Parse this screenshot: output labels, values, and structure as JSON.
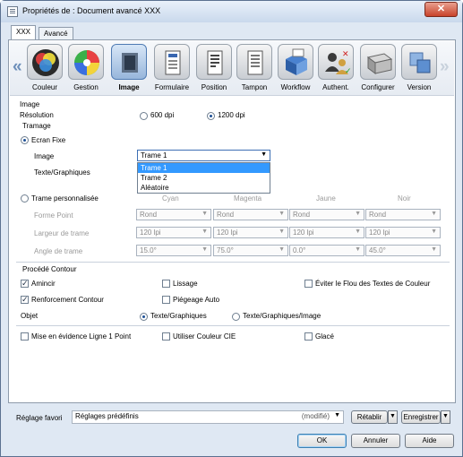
{
  "window": {
    "title": "Propriétés de : Document avancé XXX",
    "close_label": "✕"
  },
  "tabs": [
    {
      "label": "XXX"
    },
    {
      "label": "Avancé"
    }
  ],
  "toolbar": {
    "items": [
      {
        "label": "Couleur",
        "icon": "color-circles-icon"
      },
      {
        "label": "Gestion",
        "icon": "color-wheel-icon"
      },
      {
        "label": "Image",
        "icon": "image-icon"
      },
      {
        "label": "Formulaire",
        "icon": "form-icon"
      },
      {
        "label": "Position",
        "icon": "position-icon"
      },
      {
        "label": "Tampon",
        "icon": "stamp-icon"
      },
      {
        "label": "Workflow",
        "icon": "workflow-icon"
      },
      {
        "label": "Authent.",
        "icon": "authentication-icon"
      },
      {
        "label": "Configurer",
        "icon": "configure-icon"
      },
      {
        "label": "Version",
        "icon": "version-icon"
      }
    ],
    "left_arrow": "«",
    "right_arrow": "»"
  },
  "image_section": {
    "header": "Image",
    "resolution_label": "Résolution",
    "res_600": "600 dpi",
    "res_1200": "1200 dpi",
    "tramage_label": "Tramage",
    "ecran_fixe": "Ecran Fixe",
    "image_label": "Image",
    "texte_graphiques_label": "Texte/Graphiques",
    "image_select_value": "Trame 1",
    "dropdown_options": [
      "Trame 1",
      "Trame 2",
      "Aléatoire"
    ],
    "trame_perso": "Trame personnalisée",
    "col_headers": [
      "Cyan",
      "Magenta",
      "Jaune",
      "Noir"
    ],
    "forme_point_label": "Forme Point",
    "largeur_label": "Largeur de trame",
    "angle_label": "Angle de trame",
    "forme_values": [
      "Rond",
      "Rond",
      "Rond",
      "Rond"
    ],
    "largeur_values": [
      "120 lpi",
      "120 lpi",
      "120 lpi",
      "120 lpi"
    ],
    "angle_values": [
      "15.0°",
      "75.0°",
      "0.0°",
      "45.0°"
    ]
  },
  "contour_section": {
    "header": "Procédé Contour",
    "amincir": "Amincir",
    "lissage": "Lissage",
    "eviter_flou": "Éviter le Flou des Textes de Couleur",
    "renforcement": "Renforcement Contour",
    "piegeage": "Piégeage Auto",
    "objet_label": "Objet",
    "objet_texte": "Texte/Graphiques",
    "objet_texte_image": "Texte/Graphiques/Image"
  },
  "bottom_options": {
    "mise_en_evidence": "Mise en évidence Ligne 1 Point",
    "couleur_cie": "Utiliser Couleur CIE",
    "glace": "Glacé"
  },
  "favorites": {
    "label": "Réglage favori",
    "value": "Réglages prédéfinis",
    "modified": "(modifié)",
    "restore": "Rétablir",
    "save": "Enregistrer"
  },
  "footer": {
    "ok": "OK",
    "cancel": "Annuler",
    "help": "Aide"
  },
  "colors": {
    "accent": "#3399ff",
    "title_gradient_top": "#e9f1fa",
    "close_red": "#c8432b"
  }
}
